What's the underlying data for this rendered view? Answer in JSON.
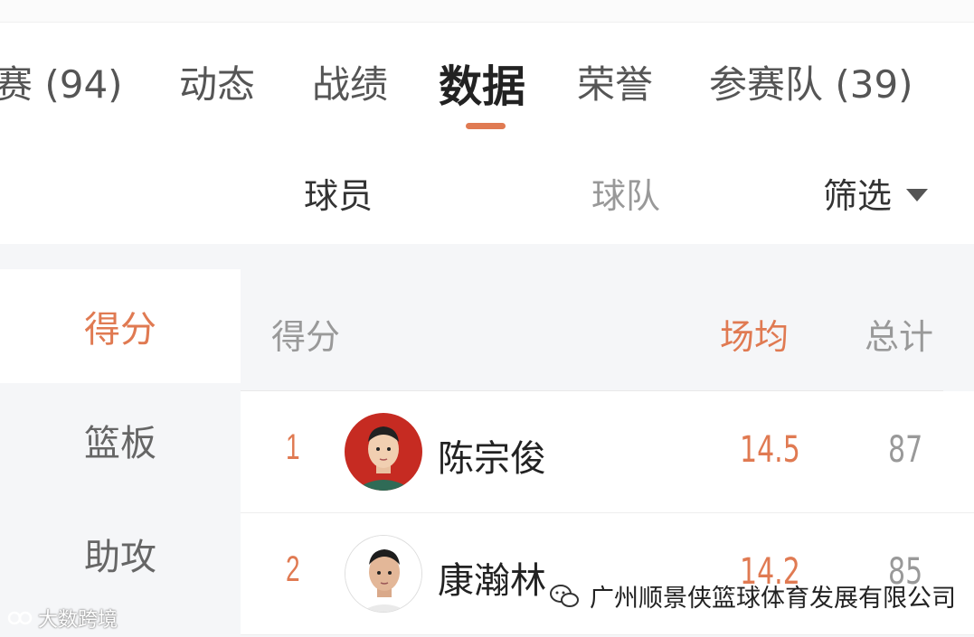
{
  "tabs": [
    {
      "label": "赛 (94)"
    },
    {
      "label": "动态"
    },
    {
      "label": "战绩"
    },
    {
      "label": "数据",
      "active": true
    },
    {
      "label": "荣誉"
    },
    {
      "label": "参赛队 (39)"
    }
  ],
  "subtabs": {
    "players": "球员",
    "teams": "球队",
    "filter": "筛选"
  },
  "sidebar": {
    "items": [
      {
        "label": "得分",
        "active": true
      },
      {
        "label": "篮板"
      },
      {
        "label": "助攻"
      }
    ]
  },
  "table": {
    "headers": {
      "category": "得分",
      "avg": "场均",
      "total": "总计"
    },
    "rows": [
      {
        "rank": "1",
        "name": "陈宗俊",
        "avg": "14.5",
        "total": "87"
      },
      {
        "rank": "2",
        "name": "康瀚林",
        "avg": "14.2",
        "total": "85"
      }
    ]
  },
  "watermarks": {
    "left": "大数跨境",
    "right": "广州顺景侠篮球体育发展有限公司"
  },
  "colors": {
    "accent": "#e07a52",
    "background": "#f5f6f8"
  }
}
